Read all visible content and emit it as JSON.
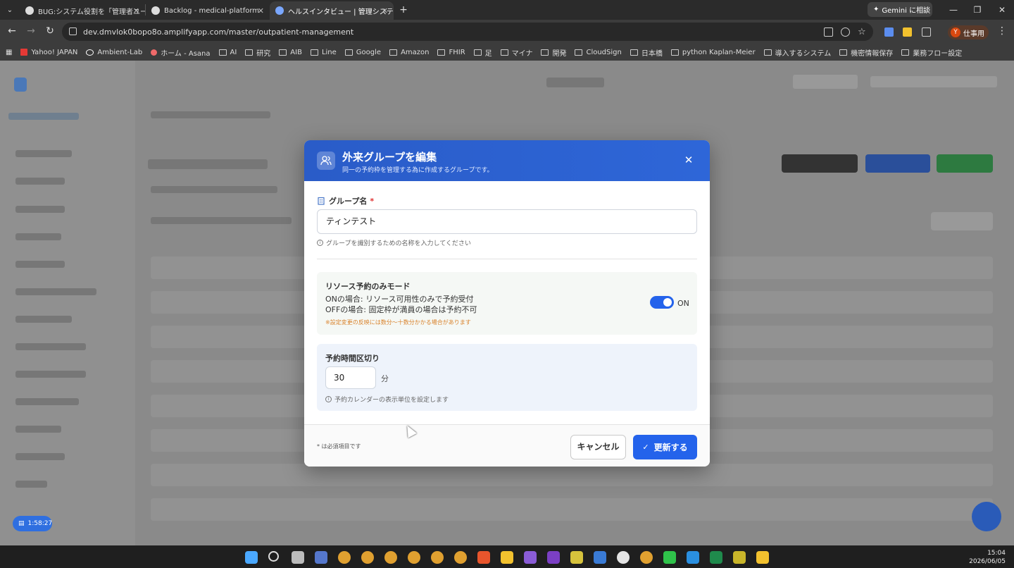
{
  "browser": {
    "tabs": [
      {
        "label": "BUG:システム役割を「管理者ユーザ",
        "active": false
      },
      {
        "label": "Backlog - medical-platform",
        "active": false
      },
      {
        "label": "ヘルスインタビュー | 管理システム",
        "active": true
      }
    ],
    "new_tab": "+",
    "gemini_label": "Gemini に相談",
    "url": "dev.dmvlok0bopo8o.amplifyapp.com/master/outpatient-management",
    "profile_initial": "Y",
    "profile_label": "仕事用",
    "bookmarks": [
      "Yahoo! JAPAN",
      "Ambient-Lab",
      "ホーム - Asana",
      "AI",
      "研究",
      "AIB",
      "Line",
      "Google",
      "Amazon",
      "FHIR",
      "足",
      "マイナ",
      "開発",
      "CloudSign",
      "日本橋",
      "python Kaplan-Meier",
      "導入するシステム",
      "機密情報保存",
      "業務フロー設定"
    ]
  },
  "background": {
    "timer": "1:58:27"
  },
  "modal": {
    "title": "外来グループを編集",
    "subtitle": "同一の予約枠を管理する為に作成するグループです。",
    "group_name_label": "グループ名",
    "required_mark": "*",
    "group_name_value": "ティンテスト",
    "group_name_hint": "グループを識別するための名称を入力してください",
    "resource_mode": {
      "title": "リソース予約のみモード",
      "line_on": "ONの場合: リソース可用性のみで予約受付",
      "line_off": "OFFの場合: 固定枠が満員の場合は予約不可",
      "warning": "※設定変更の反映には数分～十数分かかる場合があります",
      "toggle_state": "ON",
      "toggle_on": true
    },
    "slot": {
      "title": "予約時間区切り",
      "value": "30",
      "unit": "分",
      "hint": "予約カレンダーの表示単位を設定します"
    },
    "footer_note": "* は必須項目です",
    "cancel_label": "キャンセル",
    "update_label": "更新する"
  },
  "taskbar": {
    "time": "15:04",
    "date": "2026/06/05"
  }
}
